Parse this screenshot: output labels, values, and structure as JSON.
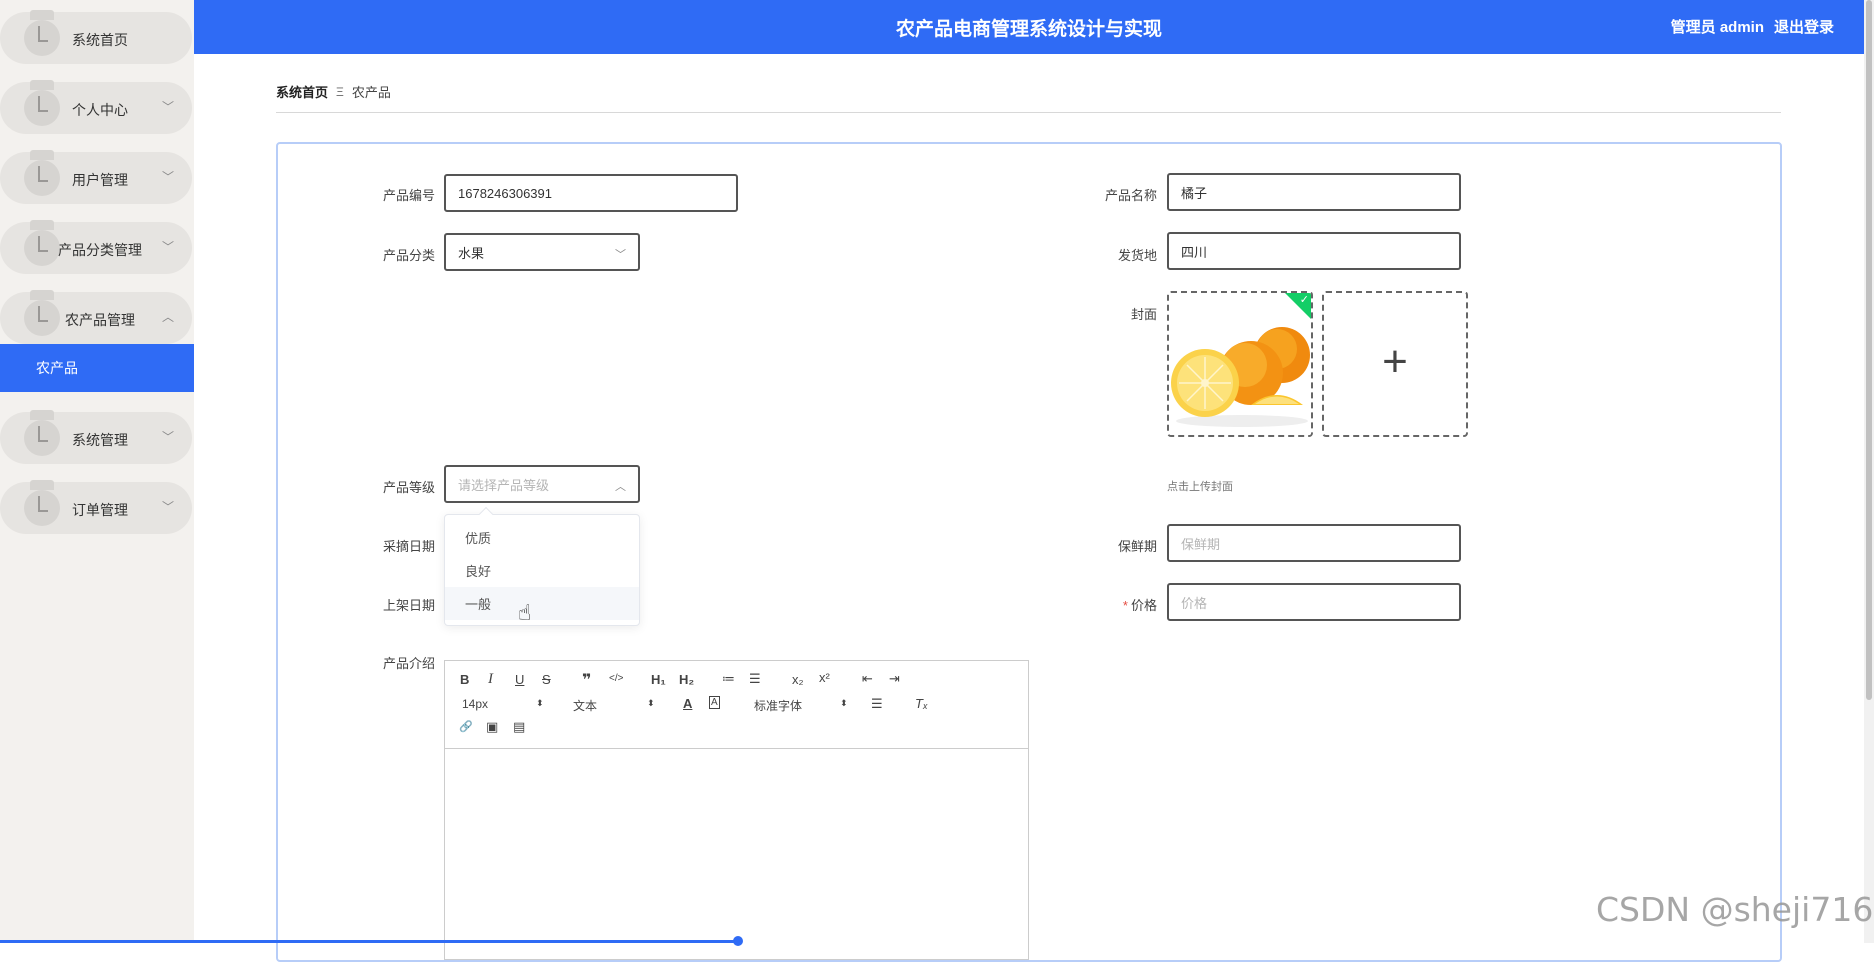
{
  "header": {
    "title": "农产品电商管理系统设计与实现",
    "user": "管理员 admin",
    "logout": "退出登录"
  },
  "sidebar": {
    "items": [
      {
        "label": "系统首页",
        "has_chevron": false
      },
      {
        "label": "个人中心",
        "has_chevron": true,
        "chevron": "﹀"
      },
      {
        "label": "用户管理",
        "has_chevron": true,
        "chevron": "﹀"
      },
      {
        "label": "产品分类管理",
        "has_chevron": true,
        "chevron": "﹀"
      },
      {
        "label": "农产品管理",
        "has_chevron": true,
        "chevron": "︿"
      },
      {
        "label": "系统管理",
        "has_chevron": true,
        "chevron": "﹀"
      },
      {
        "label": "订单管理",
        "has_chevron": true,
        "chevron": "﹀"
      }
    ],
    "active_sub": "农产品"
  },
  "breadcrumb": {
    "home": "系统首页",
    "separator": "Ξ",
    "current": "农产品"
  },
  "form": {
    "product_no_label": "产品编号",
    "product_no_value": "1678246306391",
    "product_name_label": "产品名称",
    "product_name_value": "橘子",
    "category_label": "产品分类",
    "category_value": "水果",
    "origin_label": "发货地",
    "origin_value": "四川",
    "cover_label": "封面",
    "cover_hint": "点击上传封面",
    "grade_label": "产品等级",
    "grade_placeholder": "请选择产品等级",
    "grade_options": [
      "优质",
      "良好",
      "一般"
    ],
    "pick_date_label": "采摘日期",
    "shelf_life_label": "保鲜期",
    "shelf_life_placeholder": "保鲜期",
    "listing_date_label": "上架日期",
    "price_required_mark": "*",
    "price_label": "价格",
    "price_placeholder": "价格",
    "intro_label": "产品介绍"
  },
  "editor": {
    "font_size": "14px",
    "heading": "文本",
    "font_family": "标准字体",
    "buttons": {
      "bold": "B",
      "italic": "I",
      "underline": "U",
      "strike": "S",
      "quote": "❞",
      "code": "</>",
      "h1": "H₁",
      "h2": "H₂",
      "ol": "≔",
      "ul": "☰",
      "sub": "x₂",
      "sup": "x²",
      "outdent": "⇤",
      "indent": "⇥",
      "color": "A",
      "bg": "A",
      "align": "☰",
      "clean": "Tₓ",
      "link": "🔗",
      "image": "▣",
      "video": "▤"
    }
  },
  "watermark": "CSDN @sheji716",
  "colors": {
    "primary": "#2f6bf5",
    "success": "#13ce66"
  }
}
